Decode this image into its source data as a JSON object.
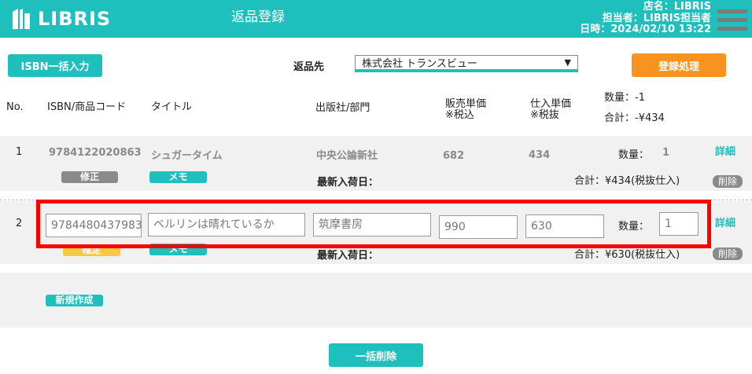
{
  "header": {
    "logo_text": "LIBRIS",
    "title": "返品登録",
    "store": "店名：LIBRIS",
    "staff": "担当者：LIBRIS担当者",
    "datetime": "日時：2024/02/10 13:22"
  },
  "toolbar": {
    "isbn_bulk_label": "ISBN一括入力",
    "return_dest_label": "返品先",
    "return_dest_value": "株式会社 トランスビュー",
    "register_label": "登録処理"
  },
  "table": {
    "headers": {
      "no": "No.",
      "isbn": "ISBN/商品コード",
      "title": "タイトル",
      "publisher": "出版社/部門",
      "sale_price_1": "販売単価",
      "sale_price_2": "※税込",
      "cost_price_1": "仕入単価",
      "cost_price_2": "※税抜",
      "qty_total": "数量：-1",
      "sum_total": "合計：-¥434"
    },
    "rows": [
      {
        "no": "1",
        "isbn": "9784122020863",
        "title": "シュガータイム",
        "publisher": "中央公論新社",
        "sale_price": "682",
        "cost_price": "434",
        "qty_label": "数量：",
        "qty": "1",
        "fix_label": "修正",
        "memo_label": "メモ",
        "arrival_label": "最新入荷日：",
        "sum": "合計：¥434(税抜仕入)",
        "detail_label": "詳細",
        "delete_label": "削除"
      },
      {
        "no": "2",
        "isbn": "9784480437983",
        "title": "ベルリンは晴れているか",
        "publisher": "筑摩書房",
        "sale_price": "990",
        "cost_price": "630",
        "qty_label": "数量：",
        "qty": "1",
        "confirm_label": "確定",
        "memo_label": "メモ",
        "arrival_label": "最新入荷日：",
        "sum": "合計：¥630(税抜仕入)",
        "detail_label": "詳細",
        "delete_label": "削除"
      }
    ],
    "new_label": "新規作成"
  },
  "footer": {
    "bulk_delete_label": "一括削除"
  },
  "colors": {
    "brand": "#1fbfbe",
    "accent": "#f7931e",
    "highlight": "#ff0000"
  },
  "icons": {
    "menu": "hamburger-menu-icon",
    "select": "chevron-down-icon",
    "logo": "libris-logo-icon"
  }
}
